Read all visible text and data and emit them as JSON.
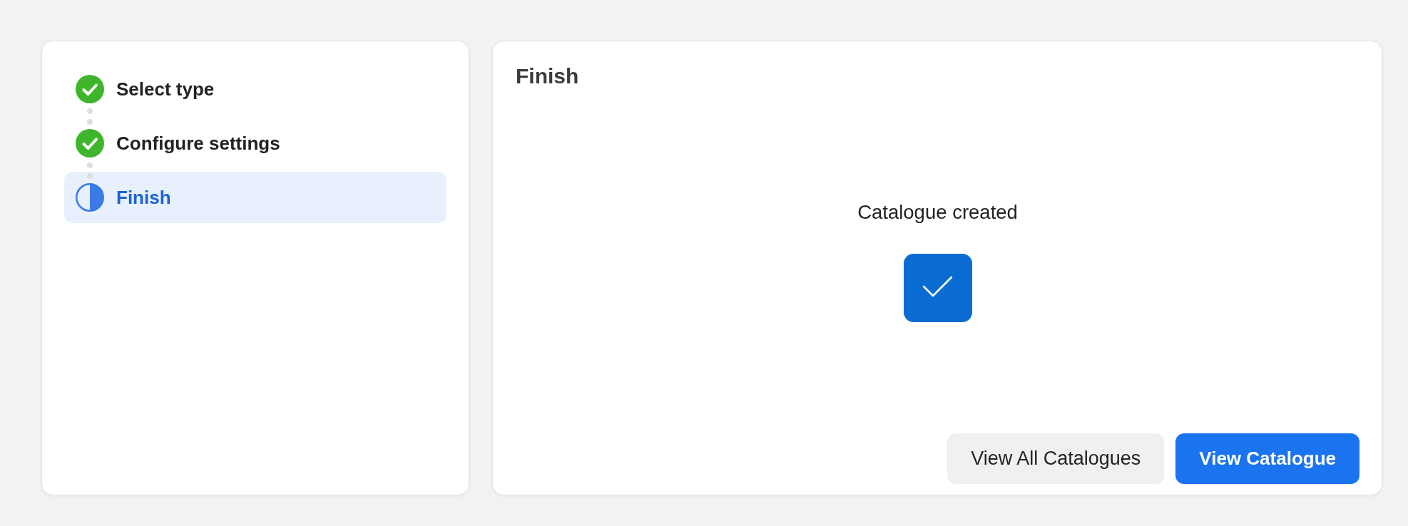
{
  "steps": [
    {
      "label": "Select type",
      "kind": "completed",
      "selected": false
    },
    {
      "label": "Configure settings",
      "kind": "completed",
      "selected": false
    },
    {
      "label": "Finish",
      "kind": "current",
      "selected": true
    }
  ],
  "panel": {
    "title": "Finish",
    "message": "Catalogue created",
    "buttons": [
      {
        "label": "View All Catalogues",
        "kind": "secondary"
      },
      {
        "label": "View Catalogue",
        "kind": "primary"
      }
    ]
  }
}
